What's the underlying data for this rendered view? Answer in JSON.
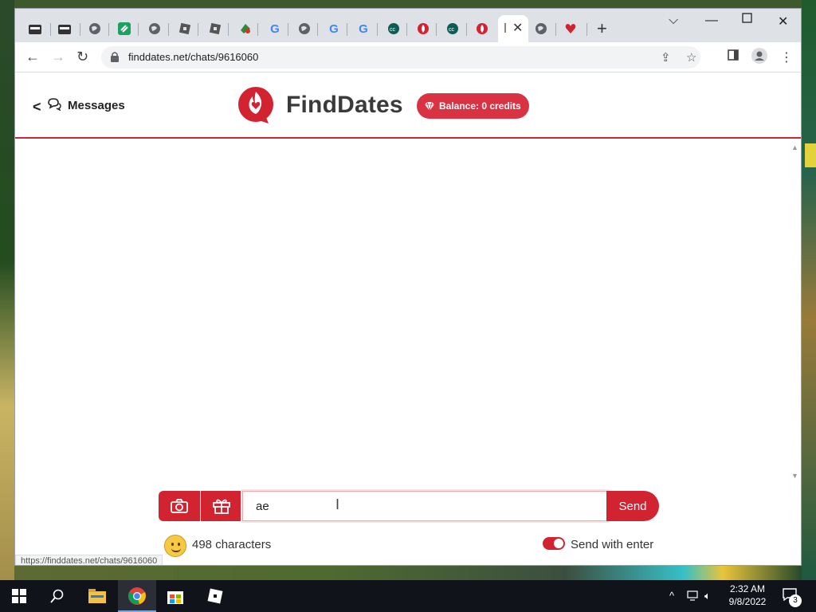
{
  "browser": {
    "tab_icons": [
      "bag-icon",
      "bag-icon",
      "globe-icon",
      "link-icon",
      "globe-icon",
      "roblox-icon",
      "roblox-icon",
      "puzzle-icon",
      "google-icon",
      "globe-icon",
      "google-icon",
      "google-icon",
      "circle-icon",
      "flame-icon",
      "circle-icon",
      "flame-icon",
      "active-tab",
      "globe-icon",
      "heart-icon"
    ],
    "new_tab_label": "+",
    "url": "finddates.net/chats/9616060",
    "status_url": "https://finddates.net/chats/9616060"
  },
  "header": {
    "back_label": "<",
    "messages_label": "Messages",
    "brand_name": "FindDates",
    "balance_label": "Balance: 0 credits"
  },
  "compose": {
    "input_value": "ae",
    "send_label": "Send",
    "characters_label": "498 characters",
    "send_with_enter_label": "Send with enter",
    "send_with_enter_on": true
  },
  "taskbar": {
    "time": "2:32 AM",
    "date": "9/8/2022",
    "notification_count": "3"
  },
  "colors": {
    "accent": "#d22330",
    "brand_text": "#3a3a3a",
    "taskbar": "#10131a"
  }
}
